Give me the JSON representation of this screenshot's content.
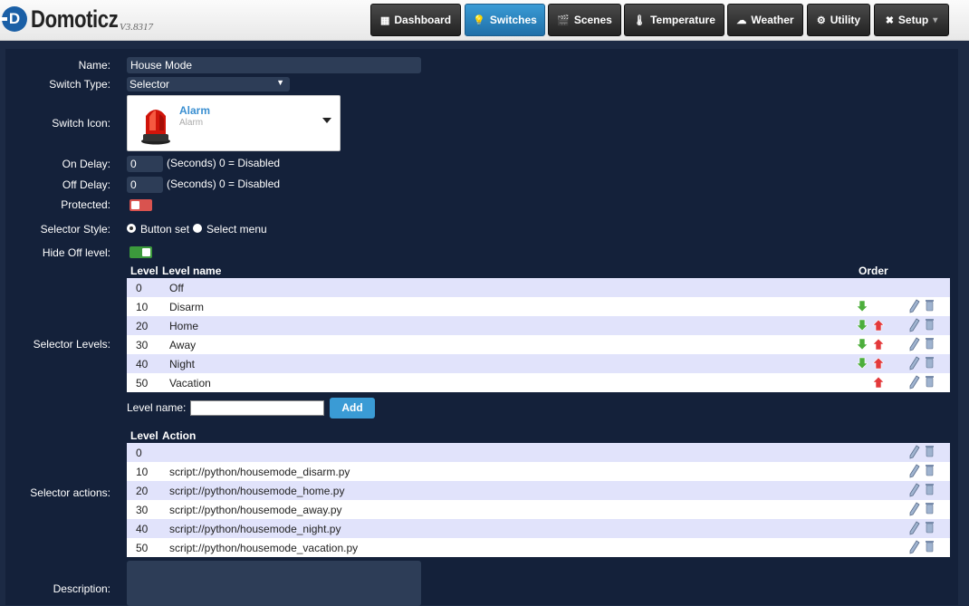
{
  "app": {
    "logo_letter": "D",
    "logo_text": "Domoticz",
    "version": "V3.8317"
  },
  "nav": [
    {
      "label": "Dashboard",
      "icon": "dashboard-icon",
      "glyph": "▦"
    },
    {
      "label": "Switches",
      "icon": "lightbulb-icon",
      "glyph": "💡"
    },
    {
      "label": "Scenes",
      "icon": "scenes-icon",
      "glyph": "🎬"
    },
    {
      "label": "Temperature",
      "icon": "thermometer-icon",
      "glyph": "🌡"
    },
    {
      "label": "Weather",
      "icon": "weather-icon",
      "glyph": "☁"
    },
    {
      "label": "Utility",
      "icon": "utility-icon",
      "glyph": "⚙"
    },
    {
      "label": "Setup",
      "icon": "wrench-icon",
      "glyph": "✖"
    }
  ],
  "nav_active": "Switches",
  "form": {
    "name_label": "Name:",
    "name_value": "House Mode",
    "switch_type_label": "Switch Type:",
    "switch_type_value": "Selector",
    "switch_icon_label": "Switch Icon:",
    "switch_icon_title": "Alarm",
    "switch_icon_sub": "Alarm",
    "on_delay_label": "On Delay:",
    "on_delay_value": "0",
    "on_delay_hint": "(Seconds) 0 = Disabled",
    "off_delay_label": "Off Delay:",
    "off_delay_value": "0",
    "off_delay_hint": "(Seconds) 0 = Disabled",
    "protected_label": "Protected:",
    "protected_on": false,
    "selector_style_label": "Selector Style:",
    "style_button_set": "Button set",
    "style_select_menu": "Select menu",
    "hide_off_label": "Hide Off level:",
    "hide_off_on": true,
    "selector_levels_label": "Selector Levels:",
    "level_name_label": "Level name:",
    "add_button": "Add",
    "selector_actions_label": "Selector actions:",
    "description_label": "Description:"
  },
  "levels_table": {
    "headers": {
      "level": "Level",
      "name": "Level name",
      "order": "Order"
    },
    "rows": [
      {
        "level": "0",
        "name": "Off",
        "down": false,
        "up": false,
        "edit": false
      },
      {
        "level": "10",
        "name": "Disarm",
        "down": true,
        "up": false,
        "edit": true
      },
      {
        "level": "20",
        "name": "Home",
        "down": true,
        "up": true,
        "edit": true
      },
      {
        "level": "30",
        "name": "Away",
        "down": true,
        "up": true,
        "edit": true
      },
      {
        "level": "40",
        "name": "Night",
        "down": true,
        "up": true,
        "edit": true
      },
      {
        "level": "50",
        "name": "Vacation",
        "down": false,
        "up": true,
        "edit": true
      }
    ]
  },
  "actions_table": {
    "headers": {
      "level": "Level",
      "action": "Action"
    },
    "rows": [
      {
        "level": "0",
        "action": ""
      },
      {
        "level": "10",
        "action": "script://python/housemode_disarm.py"
      },
      {
        "level": "20",
        "action": "script://python/housemode_home.py"
      },
      {
        "level": "30",
        "action": "script://python/housemode_away.py"
      },
      {
        "level": "40",
        "action": "script://python/housemode_night.py"
      },
      {
        "level": "50",
        "action": "script://python/housemode_vacation.py"
      }
    ]
  },
  "colors": {
    "accent": "#3a9bd5",
    "panel": "#14213a",
    "row_alt": "#e1e3fb",
    "toggle_off": "#d9534f",
    "toggle_on": "#3c9a3c"
  }
}
